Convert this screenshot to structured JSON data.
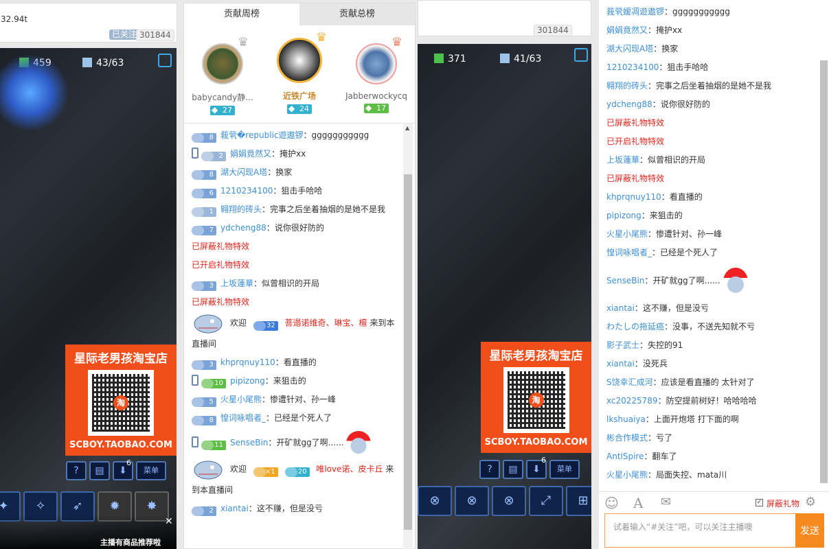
{
  "left_stream": {
    "top_text": "32.94t",
    "follow_label": "已关注",
    "follow_count": "301844",
    "minerals": "459",
    "supply": "43/63",
    "promo_title": "星际老男孩淘宝店",
    "promo_url": "SCBOY.TAOBAO.COM",
    "qr_mark": "淘",
    "recommend": "主播有商品推荐啦",
    "close": "✕",
    "hud_menu": "菜单",
    "hud_count": "6"
  },
  "right_stream": {
    "follow_count": "301844",
    "minerals": "371",
    "supply": "41/63",
    "promo_title": "星际老男孩淘宝店",
    "promo_url": "SCBOY.TAOBAO.COM",
    "qr_mark": "淘",
    "hud_menu": "菜单",
    "hud_count": "6"
  },
  "rank_panel": {
    "tabs": [
      "贡献周榜",
      "贡献总榜"
    ],
    "top3": [
      {
        "name": "babycandy静...",
        "level": "27"
      },
      {
        "name": "近铁广场",
        "level": "24"
      },
      {
        "name": "Jabberwockycq",
        "level": "17"
      }
    ]
  },
  "mid_chat": [
    {
      "badge": "8",
      "nick": "莪茕�republic遊遨锣",
      "text": "ggggggggggg"
    },
    {
      "badge": "2",
      "nick": "娟娟竟然又",
      "text": "掩护xx",
      "phone": true
    },
    {
      "badge": "8",
      "nick": "湖大闪现A塔",
      "text": "换家"
    },
    {
      "badge": "6",
      "nick": "1210234100",
      "text": "狙击手哈哈"
    },
    {
      "badge": "1",
      "nick": "翱翔的砖头",
      "text": "完事之后坐着抽烟的是她不是我"
    },
    {
      "badge": "7",
      "nick": "ydcheng88",
      "text": "说你很好防的"
    },
    {
      "sys": "已屏蔽礼物特效"
    },
    {
      "sys": "已开启礼物特效"
    },
    {
      "badge": "3",
      "nick": "上坂蓮華",
      "text": "似曾相识的开局"
    },
    {
      "sys": "已屏蔽礼物特效"
    }
  ],
  "welcome1": {
    "prefix": "欢迎",
    "level": "32",
    "names": "菩遢诺维奇、琳宝、檀",
    "suffix": "来到本直播间"
  },
  "mid_chat2": [
    {
      "badge": "3",
      "nick": "khprqnuy110",
      "text": "看直播的"
    },
    {
      "badge": "10",
      "nick": "pipizong",
      "text": "来狙击的",
      "phone": true
    },
    {
      "badge": "5",
      "nick": "火星小尾熊",
      "text": "惨遭针对、孙一峰"
    },
    {
      "badge": "8",
      "nick": "惶词咏唱者_",
      "text": "已经是个死人了"
    }
  ],
  "sense_mid": {
    "badge": "11",
    "nick": "SenseBin",
    "text": "开矿就gg了啊......"
  },
  "welcome2": {
    "prefix": "欢迎",
    "vip": "×1",
    "level": "20",
    "names": "唯love诺、皮卡丘",
    "suffix": "来到本直播间"
  },
  "mid_last": {
    "badge": "2",
    "nick": "xiantai",
    "text": "这不赚，但是没亏"
  },
  "right_chat": [
    {
      "nick": "莪茕嫒凋遊遨锣",
      "text": "ggggggggggg"
    },
    {
      "nick": "娟娟竟然又",
      "text": "掩护xx"
    },
    {
      "nick": "湖大闪现A塔",
      "text": "换家"
    },
    {
      "nick": "1210234100",
      "text": "狙击手哈哈"
    },
    {
      "nick": "翱翔的砖头",
      "text": "完事之后坐着抽烟的是她不是我"
    },
    {
      "nick": "ydcheng88",
      "text": "说你很好防的"
    },
    {
      "sys": "已屏蔽礼物特效"
    },
    {
      "sys": "已开启礼物特效"
    },
    {
      "nick": "上坂蓮華",
      "text": "似曾相识的开局"
    },
    {
      "sys": "已屏蔽礼物特效"
    },
    {
      "nick": "khprqnuy110",
      "text": "看直播的"
    },
    {
      "nick": "pipizong",
      "text": "来狙击的"
    },
    {
      "nick": "火星小尾熊",
      "text": "惨遭针对、孙一峰"
    },
    {
      "nick": "惶词咏唱者_",
      "text": "已经是个死人了"
    }
  ],
  "right_sense": {
    "nick": "SenseBin",
    "text": "开矿就gg了啊......"
  },
  "right_chat2": [
    {
      "nick": "xiantai",
      "text": "这不赚，但是没亏"
    },
    {
      "nick": "わたしの拖延癌",
      "text": "没事，不送先知就不亏"
    },
    {
      "nick": "影子武士",
      "text": "失控的91"
    },
    {
      "nick": "xiantai",
      "text": "没死兵"
    },
    {
      "nick": "S饶幸汇成河",
      "text": "应该是看直播的 太针对了"
    },
    {
      "nick": "xc20225789",
      "text": "防空提前树好！哈哈哈哈"
    },
    {
      "nick": "lkshuaiya",
      "text": "上面开炮塔 打下面的啊"
    },
    {
      "nick": "彬合作模式",
      "text": "亏了"
    },
    {
      "nick": "AntiSpire",
      "text": "翻车了"
    },
    {
      "nick": "火星小尾熊",
      "text": "局面失控、mata川"
    }
  ],
  "input": {
    "placeholder": "试着输入“#关注”吧，可以关注主播噢",
    "send": "发送",
    "shield_gift": "屏蔽礼物"
  }
}
